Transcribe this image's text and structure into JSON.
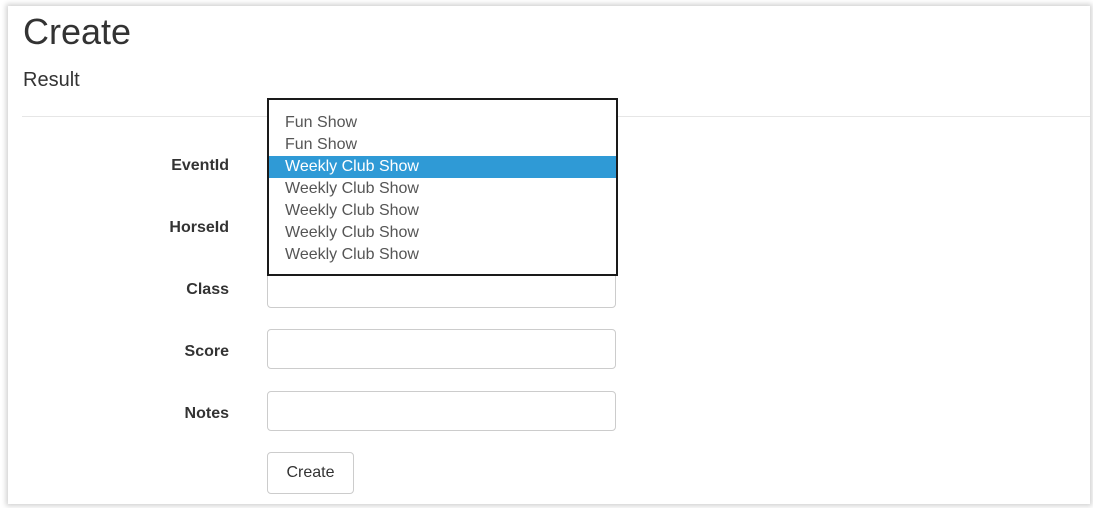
{
  "page": {
    "title": "Create",
    "subtitle": "Result"
  },
  "form": {
    "fields": [
      {
        "label": "EventId",
        "value": ""
      },
      {
        "label": "HorseId",
        "value": ""
      },
      {
        "label": "Class",
        "value": ""
      },
      {
        "label": "Score",
        "value": ""
      },
      {
        "label": "Notes",
        "value": ""
      }
    ],
    "submit_label": "Create"
  },
  "eventid_dropdown": {
    "options": [
      "Fun Show",
      "Fun Show",
      "Weekly Club Show",
      "Weekly Club Show",
      "Weekly Club Show",
      "Weekly Club Show",
      "Weekly Club Show"
    ],
    "selected_index": 2,
    "highlight_color": "#2f9ad6"
  }
}
